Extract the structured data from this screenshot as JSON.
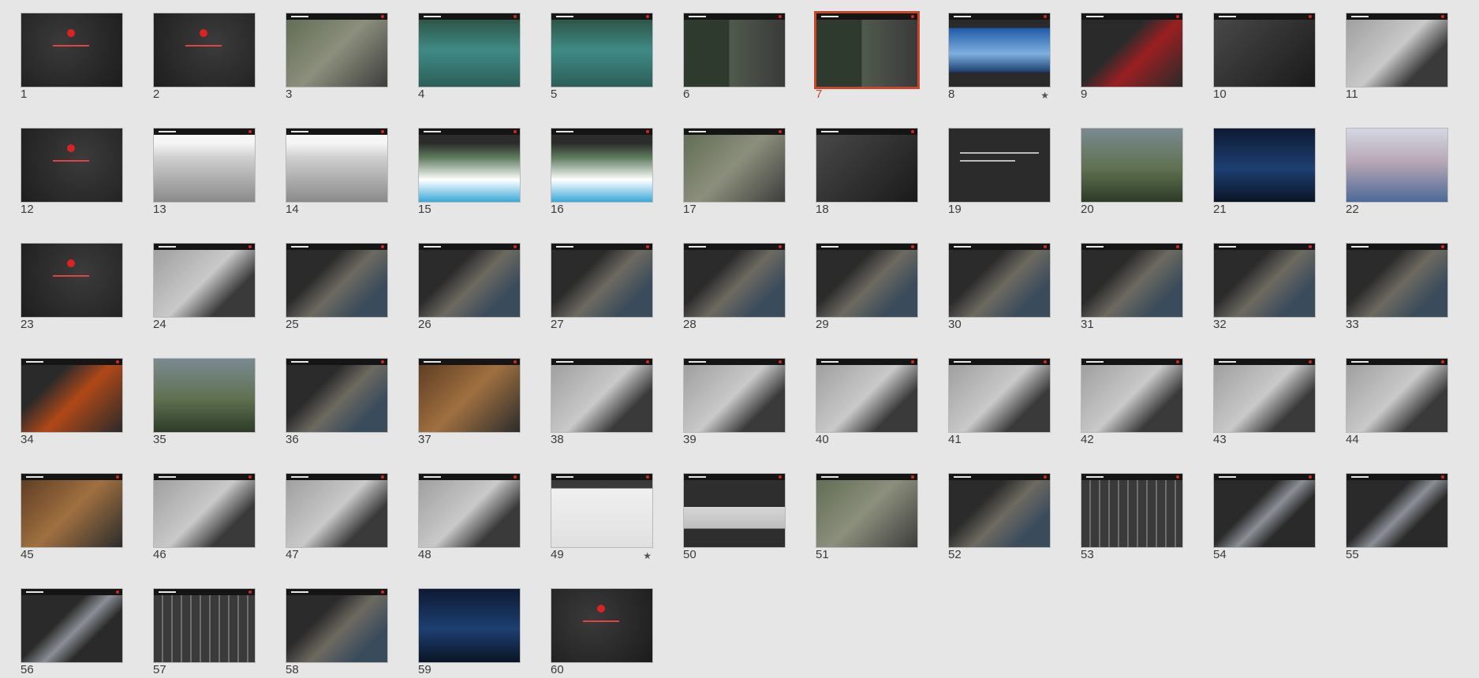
{
  "view": "slide-sorter",
  "selected_slide": 7,
  "accent_color": "#c9452b",
  "slides": [
    {
      "n": "1",
      "style": "title"
    },
    {
      "n": "2",
      "style": "section"
    },
    {
      "n": "3",
      "style": "site"
    },
    {
      "n": "4",
      "style": "lake"
    },
    {
      "n": "5",
      "style": "lake"
    },
    {
      "n": "6",
      "style": "collage"
    },
    {
      "n": "7",
      "style": "collage",
      "selected": true
    },
    {
      "n": "8",
      "style": "mountain",
      "star": "★"
    },
    {
      "n": "9",
      "style": "red"
    },
    {
      "n": "10",
      "style": "dark"
    },
    {
      "n": "11",
      "style": "plan"
    },
    {
      "n": "12",
      "style": "section"
    },
    {
      "n": "13",
      "style": "bw"
    },
    {
      "n": "14",
      "style": "bw"
    },
    {
      "n": "15",
      "style": "diagram"
    },
    {
      "n": "16",
      "style": "diagram"
    },
    {
      "n": "17",
      "style": "site"
    },
    {
      "n": "18",
      "style": "dark"
    },
    {
      "n": "19",
      "style": "text"
    },
    {
      "n": "20",
      "style": "render"
    },
    {
      "n": "21",
      "style": "night"
    },
    {
      "n": "22",
      "style": "sky"
    },
    {
      "n": "23",
      "style": "section"
    },
    {
      "n": "24",
      "style": "plan"
    },
    {
      "n": "25",
      "style": "photo"
    },
    {
      "n": "26",
      "style": "photo"
    },
    {
      "n": "27",
      "style": "photo"
    },
    {
      "n": "28",
      "style": "photo"
    },
    {
      "n": "29",
      "style": "photo"
    },
    {
      "n": "30",
      "style": "photo"
    },
    {
      "n": "31",
      "style": "photo"
    },
    {
      "n": "32",
      "style": "photo"
    },
    {
      "n": "33",
      "style": "photo"
    },
    {
      "n": "34",
      "style": "fire"
    },
    {
      "n": "35",
      "style": "render"
    },
    {
      "n": "36",
      "style": "photo"
    },
    {
      "n": "37",
      "style": "interior"
    },
    {
      "n": "38",
      "style": "plan"
    },
    {
      "n": "39",
      "style": "plan"
    },
    {
      "n": "40",
      "style": "plan"
    },
    {
      "n": "41",
      "style": "plan"
    },
    {
      "n": "42",
      "style": "plan"
    },
    {
      "n": "43",
      "style": "plan"
    },
    {
      "n": "44",
      "style": "plan"
    },
    {
      "n": "45",
      "style": "interior"
    },
    {
      "n": "46",
      "style": "plan"
    },
    {
      "n": "47",
      "style": "plan"
    },
    {
      "n": "48",
      "style": "plan"
    },
    {
      "n": "49",
      "style": "whiteplan",
      "star": "★"
    },
    {
      "n": "50",
      "style": "section2"
    },
    {
      "n": "51",
      "style": "site"
    },
    {
      "n": "52",
      "style": "photo"
    },
    {
      "n": "53",
      "style": "grid"
    },
    {
      "n": "54",
      "style": "module"
    },
    {
      "n": "55",
      "style": "module"
    },
    {
      "n": "56",
      "style": "module"
    },
    {
      "n": "57",
      "style": "grid"
    },
    {
      "n": "58",
      "style": "photo"
    },
    {
      "n": "59",
      "style": "night"
    },
    {
      "n": "60",
      "style": "title"
    }
  ]
}
